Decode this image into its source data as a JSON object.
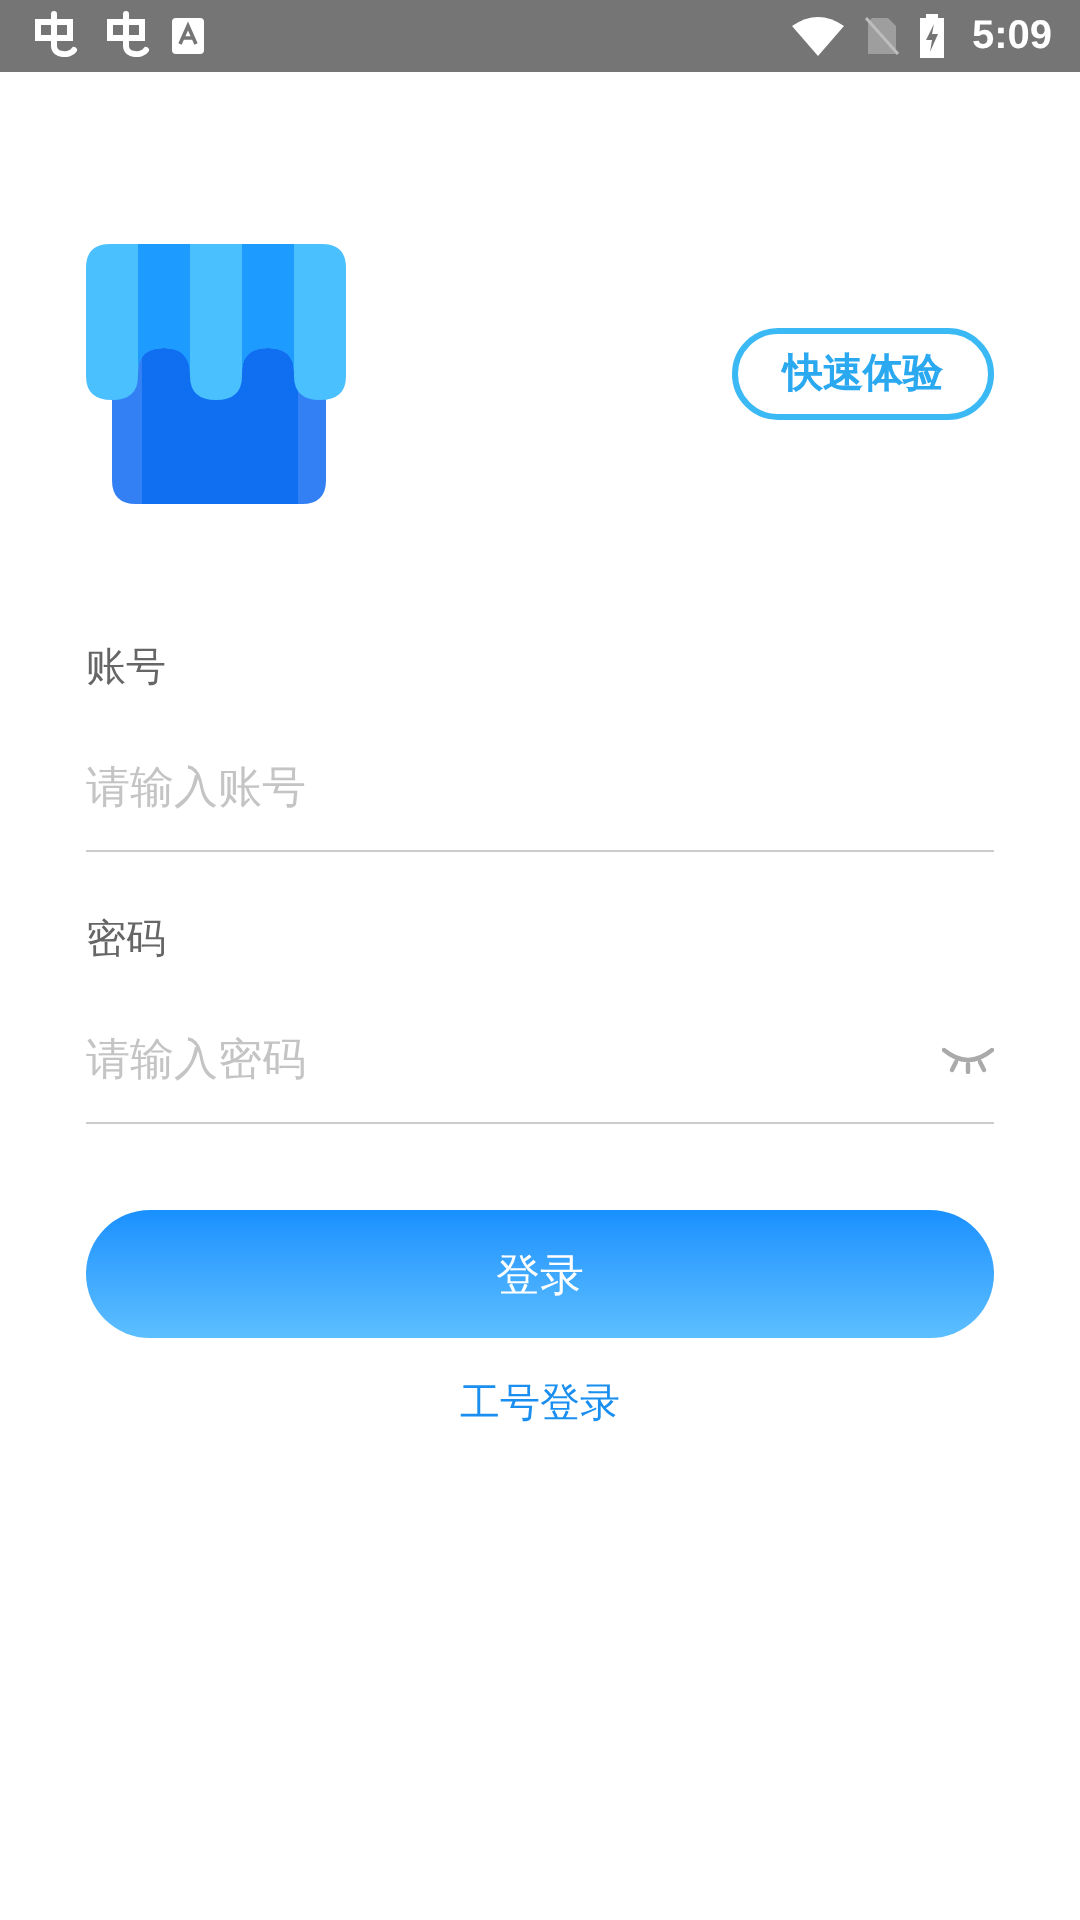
{
  "status_bar": {
    "time": "5:09"
  },
  "quick_try_button": "快速体验",
  "fields": [
    {
      "label": "账号",
      "placeholder": "请输入账号",
      "kind": "text"
    },
    {
      "label": "密码",
      "placeholder": "请输入密码",
      "kind": "password"
    }
  ],
  "login_button": "登录",
  "staff_login_link": "工号登录"
}
